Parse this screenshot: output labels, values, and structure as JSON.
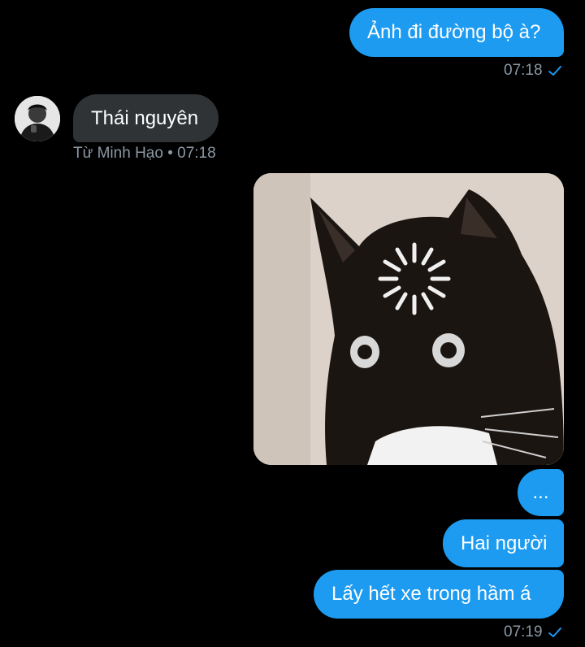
{
  "messages": [
    {
      "id": "m1",
      "direction": "outgoing",
      "text": "Ảnh đi đường bộ à?",
      "time": "07:18",
      "read": true
    },
    {
      "id": "m2",
      "direction": "incoming",
      "text": "Thái nguyên",
      "sender": "Từ Minh Hạo",
      "time": "07:18"
    },
    {
      "id": "m3",
      "direction": "outgoing",
      "type": "image",
      "image_description": "black cat with wide eyes and loading spinner"
    },
    {
      "id": "m4",
      "direction": "outgoing",
      "text": "..."
    },
    {
      "id": "m5",
      "direction": "outgoing",
      "text": "Hai người"
    },
    {
      "id": "m6",
      "direction": "outgoing",
      "text": "Lấy hết xe trong hầm á",
      "time": "07:19",
      "read": true
    }
  ],
  "meta": {
    "incoming_line": "Từ Minh Hạo • 07:18"
  },
  "colors": {
    "outgoing_bubble": "#1d9bf0",
    "incoming_bubble": "#2f3336",
    "meta_text": "#8b98a5",
    "background": "#000000"
  }
}
